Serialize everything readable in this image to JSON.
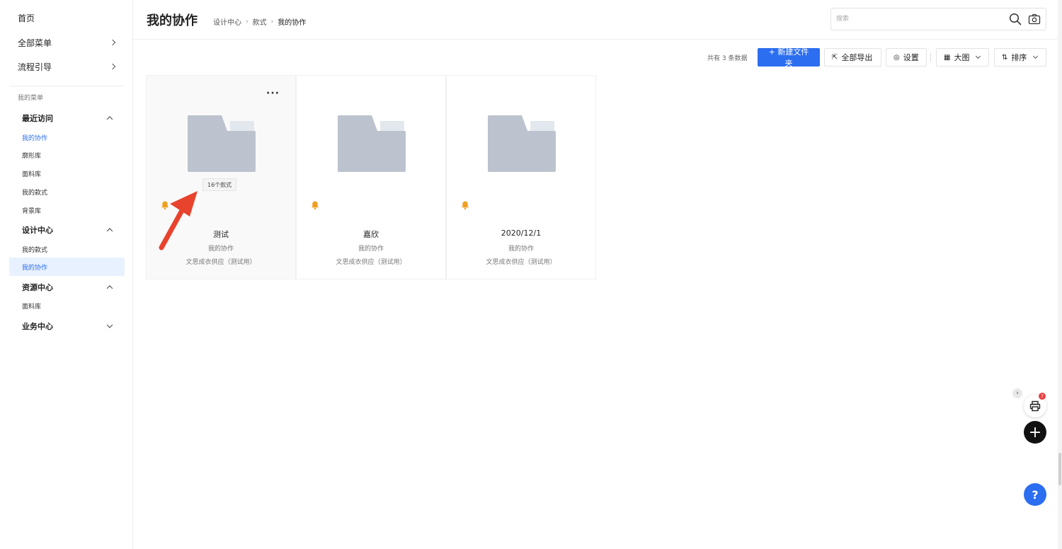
{
  "sidebar": {
    "top_items": [
      {
        "label": "首页",
        "has_chevron": false
      },
      {
        "label": "全部菜单",
        "has_chevron": true
      },
      {
        "label": "流程引导",
        "has_chevron": true
      }
    ],
    "caption": "我的菜单",
    "groups": [
      {
        "label": "最近访问",
        "expanded": true,
        "items": [
          "我的协作",
          "廓形库",
          "面料库",
          "我的款式",
          "背景库"
        ]
      },
      {
        "label": "设计中心",
        "expanded": true,
        "items": [
          "我的款式",
          "我的协作"
        ]
      },
      {
        "label": "资源中心",
        "expanded": true,
        "items": [
          "面料库"
        ]
      },
      {
        "label": "业务中心",
        "expanded": false,
        "items": []
      }
    ]
  },
  "header": {
    "title": "我的协作",
    "breadcrumb": [
      "设计中心",
      "款式",
      "我的协作"
    ],
    "search_placeholder": "搜索"
  },
  "toolbar": {
    "count_text": "共有 3 条数据",
    "new_folder": "+ 新建文件夹",
    "export_all": "全部导出",
    "settings": "设置",
    "view": "大图",
    "sort": "排序"
  },
  "cards": [
    {
      "name": "测试",
      "owner": "我的协作",
      "supplier": "文思成衣供应（测试用）",
      "count_badge": "16个款式"
    },
    {
      "name": "嘉欣",
      "owner": "我的协作",
      "supplier": "文思成衣供应（测试用）"
    },
    {
      "name": "2020/12/1",
      "owner": "我的协作",
      "supplier": "文思成衣供应（测试用）"
    }
  ],
  "floating": {
    "print_badge": "7",
    "help": "?",
    "toggle": "›",
    "add": "+"
  },
  "colors": {
    "accent": "#2b6ef0",
    "bell": "#f0a020",
    "folder": "#bcc3ce",
    "annotation_arrow": "#e8432d"
  }
}
